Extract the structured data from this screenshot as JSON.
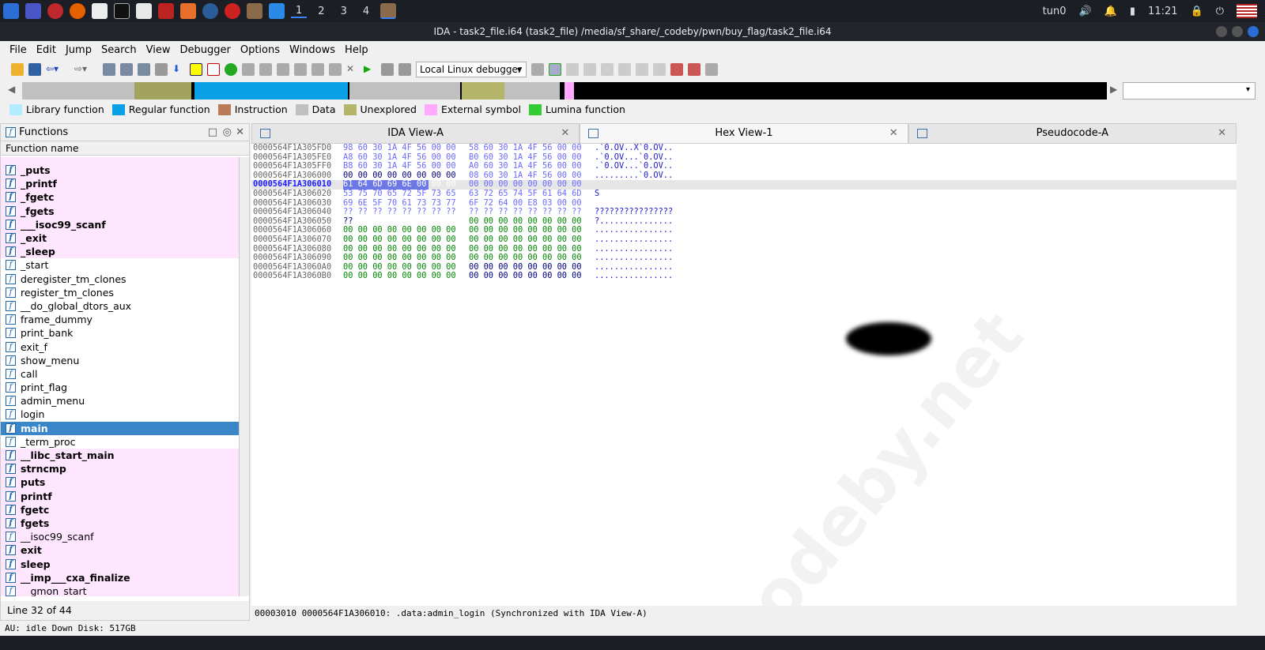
{
  "taskbar": {
    "workspaces": [
      "1",
      "2",
      "3",
      "4"
    ],
    "active_workspace": "1",
    "vpn": "tun0",
    "clock": "11:21"
  },
  "window": {
    "title": "IDA - task2_file.i64 (task2_file) /media/sf_share/_codeby/pwn/buy_flag/task2_file.i64"
  },
  "menu": [
    "File",
    "Edit",
    "Jump",
    "Search",
    "View",
    "Debugger",
    "Options",
    "Windows",
    "Help"
  ],
  "toolbar": {
    "debugger_select": "Local Linux debugger"
  },
  "legend": [
    {
      "label": "Library function",
      "color": "#b3ecff"
    },
    {
      "label": "Regular function",
      "color": "#0aa0e6"
    },
    {
      "label": "Instruction",
      "color": "#b97a57"
    },
    {
      "label": "Data",
      "color": "#c0c0c0"
    },
    {
      "label": "Unexplored",
      "color": "#b5b56a"
    },
    {
      "label": "External symbol",
      "color": "#ffaaff"
    },
    {
      "label": "Lumina function",
      "color": "#33cc33"
    }
  ],
  "functions": {
    "title": "Functions",
    "column": "Function name",
    "items": [
      {
        "name": "_puts",
        "imp": true
      },
      {
        "name": "_printf",
        "imp": true
      },
      {
        "name": "_fgetc",
        "imp": true
      },
      {
        "name": "_fgets",
        "imp": true
      },
      {
        "name": "___isoc99_scanf",
        "imp": true
      },
      {
        "name": "_exit",
        "imp": true
      },
      {
        "name": "_sleep",
        "imp": true
      },
      {
        "name": "_start"
      },
      {
        "name": "deregister_tm_clones"
      },
      {
        "name": "register_tm_clones"
      },
      {
        "name": "__do_global_dtors_aux"
      },
      {
        "name": "frame_dummy"
      },
      {
        "name": "print_bank"
      },
      {
        "name": "exit_f"
      },
      {
        "name": "show_menu"
      },
      {
        "name": "call"
      },
      {
        "name": "print_flag"
      },
      {
        "name": "admin_menu"
      },
      {
        "name": "login"
      },
      {
        "name": "main",
        "sel": true
      },
      {
        "name": "_term_proc"
      },
      {
        "name": "__libc_start_main",
        "imp": true
      },
      {
        "name": "strncmp",
        "imp": true
      },
      {
        "name": "puts",
        "imp": true
      },
      {
        "name": "printf",
        "imp": true
      },
      {
        "name": "fgetc",
        "imp": true
      },
      {
        "name": "fgets",
        "imp": true
      },
      {
        "name": "__isoc99_scanf",
        "imp": true,
        "normal": true
      },
      {
        "name": "exit",
        "imp": true
      },
      {
        "name": "sleep",
        "imp": true
      },
      {
        "name": "__imp___cxa_finalize",
        "imp": true
      },
      {
        "name": "__gmon_start__",
        "imp": true,
        "normal": true
      }
    ],
    "status": "Line 32 of 44"
  },
  "tabs": [
    {
      "label": "IDA View-A"
    },
    {
      "label": "Hex View-1",
      "active": true
    },
    {
      "label": "Pseudocode-A"
    }
  ],
  "hex": {
    "rows": [
      {
        "addr": "0000564F1A305FD0",
        "b1": "98 60 30 1A 4F 56 00 00",
        "b2": "58 60 30 1A 4F 56 00 00",
        "ascii": ".`0.OV..X`0.OV..",
        "c1": "#6a6aff",
        "c2": "#6a6aff"
      },
      {
        "addr": "0000564F1A305FE0",
        "b1": "A8 60 30 1A 4F 56 00 00",
        "b2": "B0 60 30 1A 4F 56 00 00",
        "ascii": ".`0.OV...`0.OV..",
        "c1": "#6a6aff",
        "c2": "#6a6aff"
      },
      {
        "addr": "0000564F1A305FF0",
        "b1": "B8 60 30 1A 4F 56 00 00",
        "b2": "A0 60 30 1A 4F 56 00 00",
        "ascii": ".`0.OV...`0.OV..",
        "c1": "#6a6aff",
        "c2": "#6a6aff"
      },
      {
        "addr": "0000564F1A306000",
        "b1": "00 00 00 00 00 00 00 00",
        "b2": "08 60 30 1A 4F 56 00 00",
        "ascii": ".........`0.OV..",
        "c1": "#000080",
        "c2": "#6a6aff"
      },
      {
        "addr": "0000564F1A306010",
        "b1": "61 64 6D 69 6E 00 00 00",
        "b2": "00 00 00 00 00 00 00 00",
        "ascii": "",
        "c1": "#6a6aff",
        "c2": "#6a6aff",
        "cur": true
      },
      {
        "addr": "0000564F1A306020",
        "b1": "53 75 70 65 72 5F 73 65",
        "b2": "63 72 65 74 5F 61 64 6D",
        "ascii": "S",
        "c1": "#6a6aff",
        "c2": "#6a6aff"
      },
      {
        "addr": "0000564F1A306030",
        "b1": "69 6E 5F 70 61 73 73 77",
        "b2": "6F 72 64 00 E8 03 00 00",
        "ascii": "",
        "c1": "#6a6aff",
        "c2": "#6a6aff"
      },
      {
        "addr": "0000564F1A306040",
        "b1": "?? ?? ?? ?? ?? ?? ?? ??",
        "b2": "?? ?? ?? ?? ?? ?? ?? ??",
        "ascii": "????????????????",
        "c1": "#6a6aff",
        "c2": "#6a6aff"
      },
      {
        "addr": "0000564F1A306050",
        "b1": "??",
        "b2": "00 00 00 00 00 00 00 00",
        "ascii": "?...............",
        "c1": "#000080",
        "c2": "#008800"
      },
      {
        "addr": "0000564F1A306060",
        "b1": "00 00 00 00 00 00 00 00",
        "b2": "00 00 00 00 00 00 00 00",
        "ascii": "................",
        "c1": "#008800",
        "c2": "#008800"
      },
      {
        "addr": "0000564F1A306070",
        "b1": "00 00 00 00 00 00 00 00",
        "b2": "00 00 00 00 00 00 00 00",
        "ascii": "................",
        "c1": "#008800",
        "c2": "#008800"
      },
      {
        "addr": "0000564F1A306080",
        "b1": "00 00 00 00 00 00 00 00",
        "b2": "00 00 00 00 00 00 00 00",
        "ascii": "................",
        "c1": "#008800",
        "c2": "#008800"
      },
      {
        "addr": "0000564F1A306090",
        "b1": "00 00 00 00 00 00 00 00",
        "b2": "00 00 00 00 00 00 00 00",
        "ascii": "................",
        "c1": "#008800",
        "c2": "#008800"
      },
      {
        "addr": "0000564F1A3060A0",
        "b1": "00 00 00 00 00 00 00 00",
        "b2": "00 00 00 00 00 00 00 00",
        "ascii": "................",
        "c1": "#008800",
        "c2": "#000080"
      },
      {
        "addr": "0000564F1A3060B0",
        "b1": "00 00 00 00 00 00 00 00",
        "b2": "00 00 00 00 00 00 00 00",
        "ascii": "................",
        "c1": "#008800",
        "c2": "#000080"
      }
    ],
    "status": "00003010 0000564F1A306010: .data:admin_login (Synchronized with IDA View-A)"
  },
  "watermark": "codeby.net",
  "footer": "AU:  idle   Down    Disk: 517GB"
}
